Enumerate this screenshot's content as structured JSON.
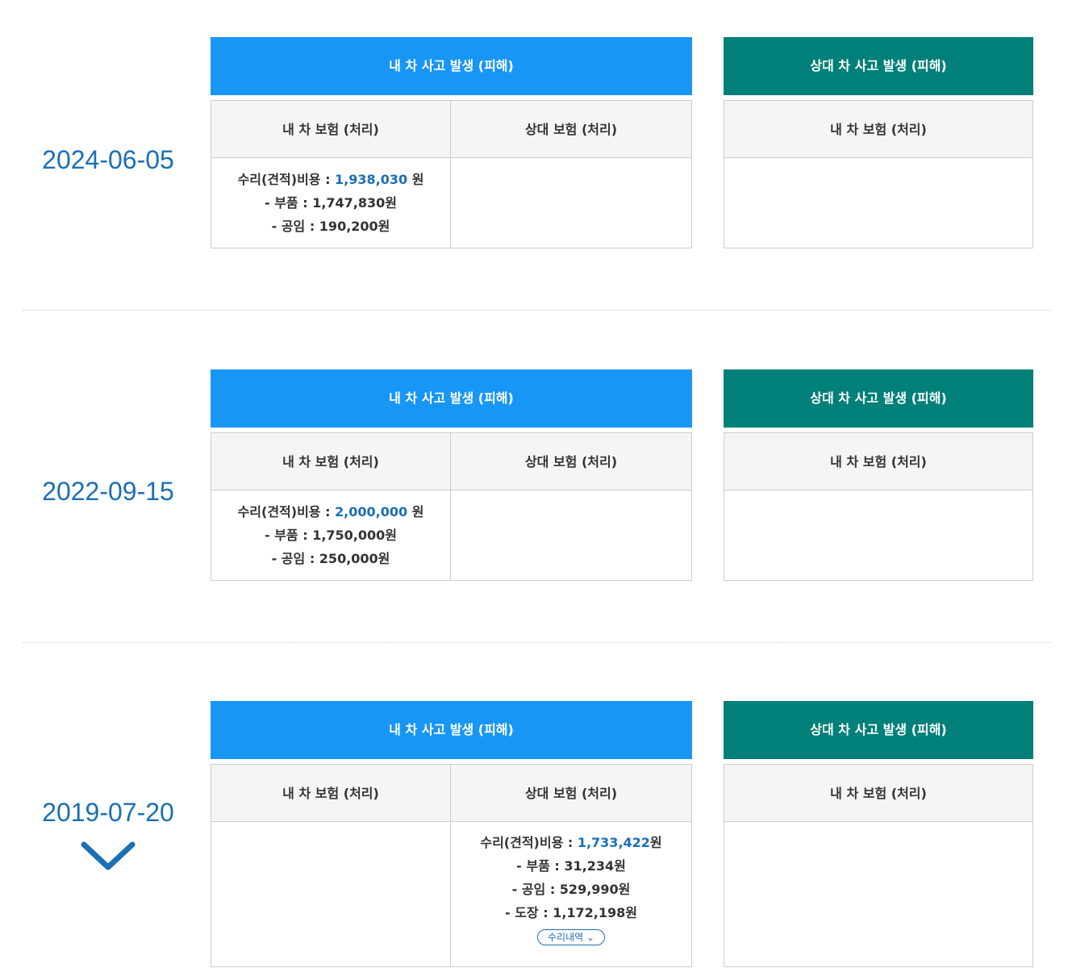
{
  "labels": {
    "my_accident": "내 차 사고 발생 (피해)",
    "other_accident": "상대 차 사고 발생 (피해)",
    "my_insurance": "내 차 보험 (처리)",
    "other_insurance": "상대 보험 (처리)",
    "repair_cost": "수리(견적)비용 : ",
    "parts": "- 부품 : ",
    "labor": "- 공임 : ",
    "paint": "- 도장 : ",
    "won_spaced": " 원",
    "won": "원",
    "repair_history_button": "수리내역 ⌄"
  },
  "records": [
    {
      "date": "2024-06-05",
      "my_insurance": {
        "repair_cost": "1,938,030",
        "parts": "1,747,830",
        "labor": "190,200"
      }
    },
    {
      "date": "2022-09-15",
      "my_insurance": {
        "repair_cost": "2,000,000",
        "parts": "1,750,000",
        "labor": "250,000"
      }
    },
    {
      "date": "2019-07-20",
      "other_insurance": {
        "repair_cost": "1,733,422",
        "parts": "31,234",
        "labor": "529,990",
        "paint": "1,172,198"
      }
    }
  ],
  "colors": {
    "accent_blue": "#1896f5",
    "accent_teal": "#008079",
    "value_blue": "#1b6fb5"
  },
  "icons": {
    "expand": "chevron-down-icon"
  }
}
